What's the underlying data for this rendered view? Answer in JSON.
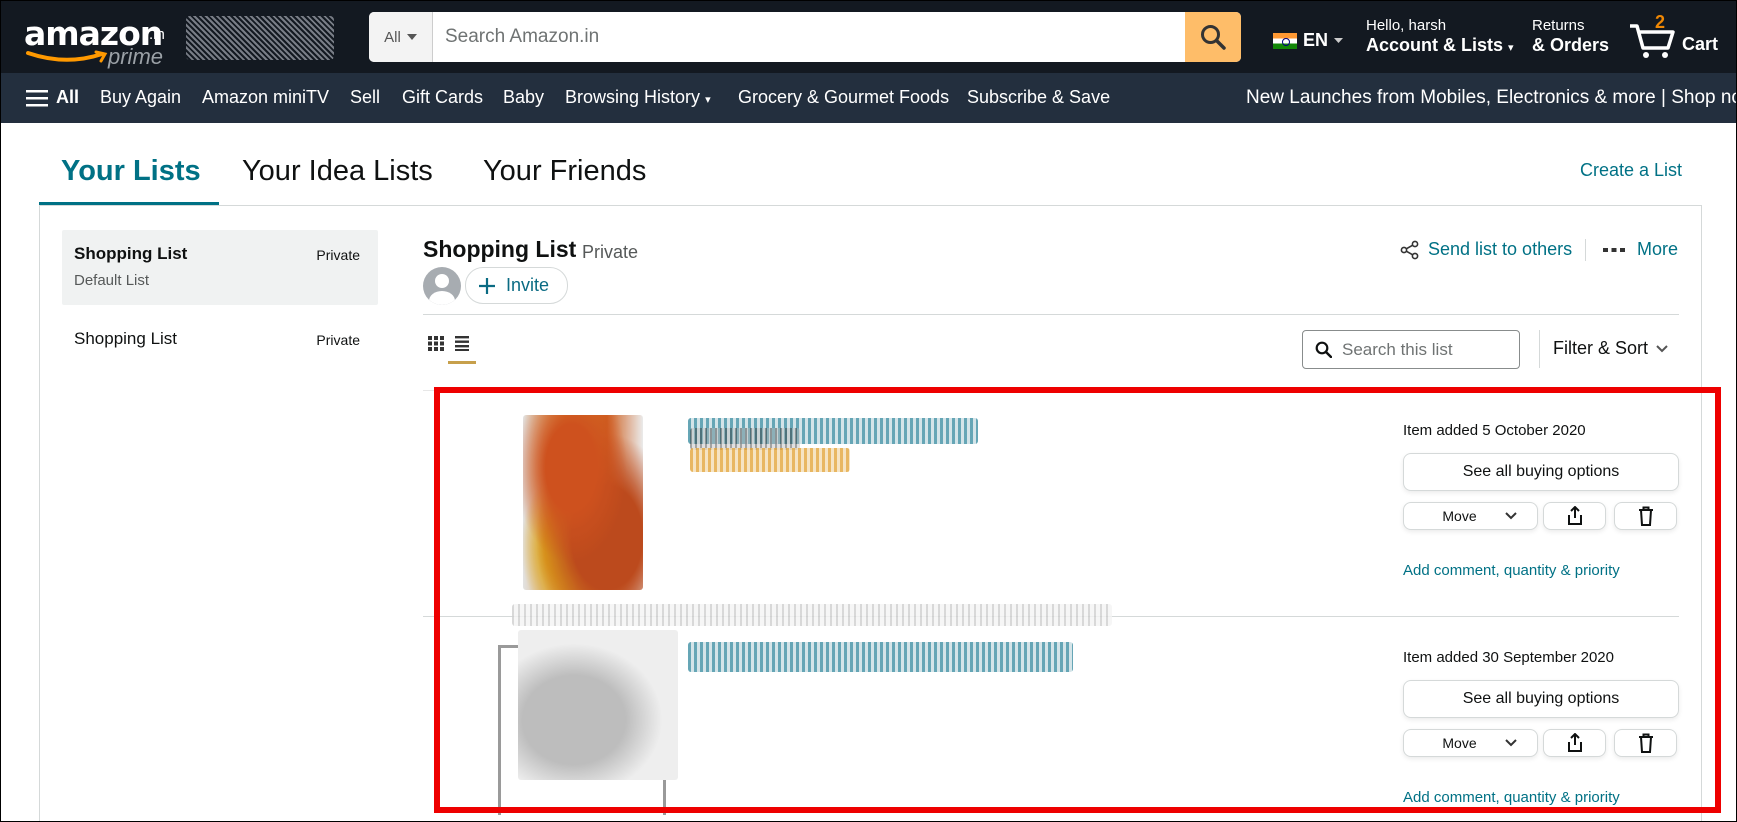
{
  "header": {
    "logo": {
      "word": "amazon",
      "tld": ".in",
      "sub": "prime"
    },
    "search": {
      "category": "All",
      "placeholder": "Search Amazon.in"
    },
    "language": "EN",
    "account": {
      "greeting": "Hello, harsh",
      "label": "Account & Lists"
    },
    "orders": {
      "line1": "Returns",
      "line2": "& Orders"
    },
    "cart": {
      "count": "2",
      "label": "Cart"
    }
  },
  "nav": {
    "all_label": "All",
    "items": [
      "Buy Again",
      "Amazon miniTV",
      "Sell",
      "Gift Cards",
      "Baby",
      "Browsing History",
      "Grocery & Gourmet Foods",
      "Subscribe & Save"
    ],
    "promo": "New Launches from Mobiles, Electronics & more | Shop now"
  },
  "tabs": [
    "Your Lists",
    "Your Idea Lists",
    "Your Friends"
  ],
  "create_list": "Create a List",
  "sidebar": {
    "lists": [
      {
        "name": "Shopping List",
        "privacy": "Private",
        "sub": "Default List"
      },
      {
        "name": "Shopping List",
        "privacy": "Private"
      }
    ]
  },
  "list_header": {
    "title": "Shopping List",
    "privacy": "Private",
    "invite": "Invite",
    "send": "Send list to others",
    "more": "More"
  },
  "toolbar": {
    "search_placeholder": "Search this list",
    "filter_sort": "Filter & Sort"
  },
  "items": [
    {
      "added": "Item added 5 October 2020",
      "buy": "See all buying options",
      "move": "Move",
      "add_link": "Add comment, quantity & priority"
    },
    {
      "added": "Item added 30 September 2020",
      "buy": "See all buying options",
      "move": "Move",
      "add_link": "Add comment, quantity & priority"
    }
  ],
  "colors": {
    "header_bg": "#131921",
    "nav_bg": "#232f3e",
    "accent_teal": "#007185",
    "search_button": "#febd69",
    "cart_count": "#f08804",
    "highlight_box": "#ee0000"
  }
}
